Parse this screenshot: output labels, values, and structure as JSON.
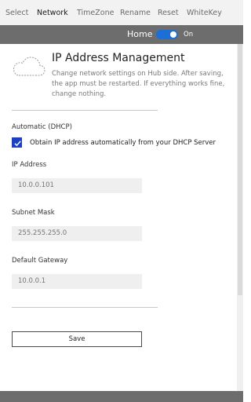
{
  "nav": {
    "items": [
      {
        "label": "Select",
        "active": false
      },
      {
        "label": "Network",
        "active": true
      },
      {
        "label": "TimeZone",
        "active": false
      },
      {
        "label": "Rename",
        "active": false
      },
      {
        "label": "Reset",
        "active": false
      },
      {
        "label": "WhiteKey",
        "active": false
      }
    ]
  },
  "home": {
    "label": "Home",
    "toggle_state": "On",
    "toggle_on": true
  },
  "page": {
    "title": "IP Address Management",
    "description": "Change network settings on Hub side. After saving, the app must be restarted. If everything works fine, change nothing.",
    "icon": "cloud-icon"
  },
  "dhcp": {
    "section_label": "Automatic (DHCP)",
    "checkbox_label": "Obtain IP address automatically from your DHCP Server",
    "checked": true
  },
  "fields": {
    "ip": {
      "label": "IP Address",
      "placeholder": "10.0.0.101"
    },
    "subnet": {
      "label": "Subnet Mask",
      "placeholder": "255.255.255.0"
    },
    "gateway": {
      "label": "Default Gateway",
      "placeholder": "10.0.0.1"
    }
  },
  "actions": {
    "save_label": "Save"
  },
  "colors": {
    "accent": "#1c6fd6",
    "checkbox": "#1a3fc9",
    "strip": "#6d6d6d",
    "nav_bg": "#f2f2f2",
    "field_bg": "#efefef"
  }
}
